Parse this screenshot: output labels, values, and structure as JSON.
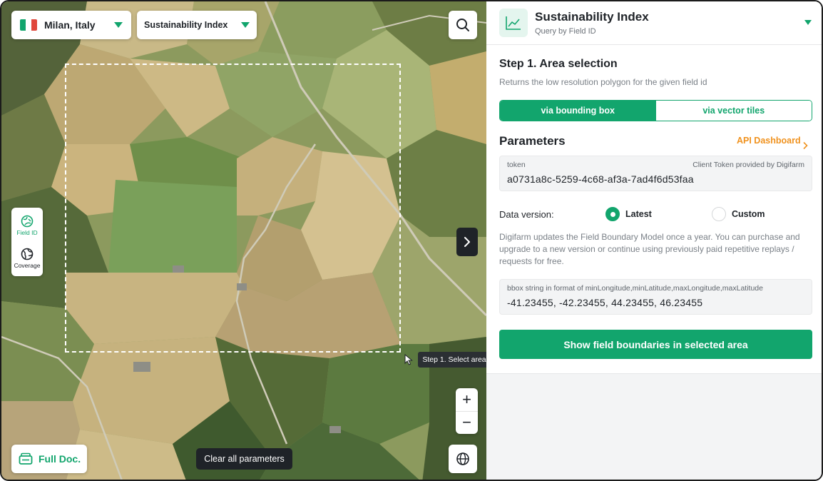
{
  "map": {
    "location": "Milan, Italy",
    "index_select": "Sustainability Index",
    "tools": [
      {
        "label": "Field ID",
        "icon": "field-id-icon",
        "active": true
      },
      {
        "label": "Coverage",
        "icon": "coverage-icon",
        "active": false
      }
    ],
    "full_doc": "Full Doc.",
    "clear": "Clear all parameters",
    "tooltip": "Step 1. Select area",
    "zoom_in": "+",
    "zoom_out": "−"
  },
  "panel": {
    "title": "Sustainability Index",
    "subtitle": "Query by Field ID",
    "step_title": "Step 1. Area selection",
    "step_desc": "Returns the low resolution polygon for the given field id",
    "tabs": [
      {
        "label": "via bounding box",
        "active": true
      },
      {
        "label": "via vector tiles",
        "active": false
      }
    ],
    "params_title": "Parameters",
    "api_link": "API Dashboard",
    "token": {
      "label": "token",
      "hint": "Client Token provided by Digifarm",
      "value": "a0731a8c-5259-4c68-af3a-7ad4f6d53faa"
    },
    "data_version": {
      "label": "Data version:",
      "options": [
        "Latest",
        "Custom"
      ],
      "selected": "Latest"
    },
    "info": "Digifarm updates the Field Boundary Model once a year. You can purchase and upgrade to a new version or continue using previously paid repetitive replays / requests for free.",
    "bbox": {
      "label": "bbox string in format of minLongitude,minLatitude,maxLongitude,maxLatitude",
      "value": "-41.23455, -42.23455, 44.23455, 46.23455"
    },
    "cta": "Show field boundaries in selected area"
  },
  "colors": {
    "accent": "#12a56d",
    "link": "#f0921e",
    "dark": "#1f2328"
  }
}
